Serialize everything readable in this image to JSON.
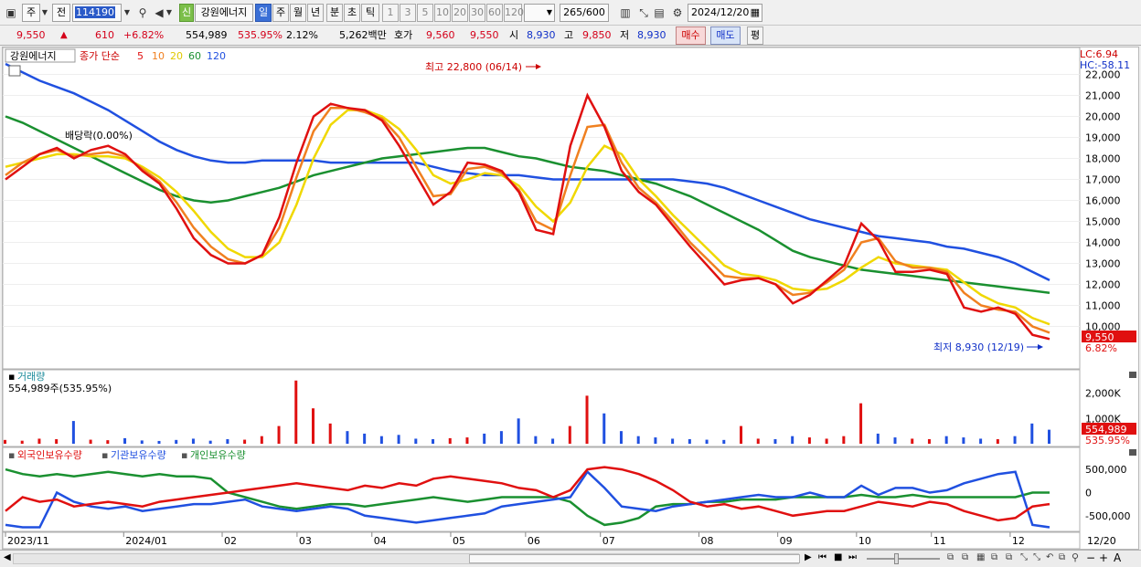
{
  "toolbar": {
    "market_label": "주",
    "prev_label": "전",
    "code_value": "114190",
    "new_badge": "신",
    "stock_name": "강원에너지",
    "period_tabs": [
      "일",
      "주",
      "월",
      "년",
      "분",
      "초",
      "틱"
    ],
    "selected_period": "일",
    "minute_units": [
      "1",
      "3",
      "5",
      "10",
      "20",
      "30",
      "60",
      "120"
    ],
    "count_value": "265",
    "count_total": "/600",
    "date_value": "2024/12/20"
  },
  "quote": {
    "price": "9,550",
    "change": "610",
    "change_pct": "+6.82%",
    "volume": "554,989",
    "volume_ratio": "535.95%",
    "turnover": "2.12%",
    "amount": "5,262백만",
    "ask_label": "호가",
    "ask": "9,560",
    "bid": "9,550",
    "open_label": "시",
    "open": "8,930",
    "high_label": "고",
    "high": "9,850",
    "low_label": "저",
    "low": "8,930",
    "buy_button": "매수",
    "sell_button": "매도",
    "eval_button": "평"
  },
  "price_panel": {
    "stock_label": "강원에너지",
    "legend_prefix": "종가 단순",
    "ma_labels": [
      "5",
      "10",
      "20",
      "60",
      "120"
    ],
    "ma_colors": [
      "#e01010",
      "#f08020",
      "#f0d800",
      "#1a9030",
      "#2050e0"
    ],
    "lc_label": "LC:6.94",
    "hc_label": "HC:-58.11",
    "high_annotation": "최고 22,800 (06/14)",
    "low_annotation": "최저 8,930 (12/19)",
    "dividend_annotation": "배당락(0.00%)",
    "current_price_tag": "9,550",
    "current_pct_tag": "6.82%"
  },
  "volume_panel": {
    "title": "거래량",
    "subtitle": "554,989주(535.95%)",
    "current_tag": "554,989",
    "current_pct_tag": "535.95%"
  },
  "holding_panel": {
    "series_labels": [
      "외국인보유수량",
      "기관보유수량",
      "개인보유수량"
    ],
    "series_colors": [
      "#e01010",
      "#2050e0",
      "#1a9030"
    ]
  },
  "chart_data": {
    "type": "line",
    "price_axis": {
      "min": 8500,
      "max": 22500,
      "ticks": [
        10000,
        11000,
        12000,
        13000,
        14000,
        15000,
        16000,
        17000,
        18000,
        19000,
        20000,
        21000,
        22000
      ]
    },
    "price_tick_labels": [
      "10,000",
      "11,000",
      "12,000",
      "13,000",
      "14,000",
      "15,000",
      "16,000",
      "17,000",
      "18,000",
      "19,000",
      "20,000",
      "21,000",
      "22,000"
    ],
    "volume_tick_labels": [
      "1,000K",
      "2,000K"
    ],
    "volume_ticks": [
      1000,
      2000
    ],
    "holding_tick_labels": [
      "500,000",
      "0",
      "-500,000"
    ],
    "holding_ticks": [
      500000,
      0,
      -500000
    ],
    "x_labels": [
      "2023/11",
      "2024/01",
      "02",
      "03",
      "04",
      "05",
      "06",
      "07",
      "08",
      "09",
      "10",
      "11",
      "12",
      "12/20"
    ],
    "x_label_positions": [
      0,
      30,
      55,
      74,
      93,
      113,
      132,
      151,
      176,
      196,
      216,
      235,
      255,
      265
    ],
    "ma5": [
      17000,
      17600,
      18200,
      18500,
      18000,
      18400,
      18600,
      18200,
      17400,
      16800,
      15600,
      14200,
      13400,
      13000,
      13000,
      13400,
      15200,
      17800,
      20000,
      20600,
      20400,
      20300,
      19800,
      18600,
      17200,
      15800,
      16400,
      17800,
      17700,
      17400,
      16400,
      14600,
      14400,
      18600,
      21000,
      19500,
      17400,
      16400,
      15800,
      14800,
      13800,
      12900,
      12000,
      12200,
      12300,
      12000,
      11100,
      11500,
      12200,
      12900,
      14900,
      14100,
      12600,
      12600,
      12700,
      12500,
      10900,
      10700,
      10900,
      10600,
      9600,
      9400
    ],
    "ma10": [
      17200,
      17800,
      18200,
      18400,
      18100,
      18200,
      18300,
      18100,
      17500,
      16900,
      15900,
      14700,
      13800,
      13200,
      13000,
      13400,
      14700,
      17100,
      19300,
      20400,
      20400,
      20200,
      19900,
      19000,
      17600,
      16200,
      16300,
      17500,
      17600,
      17300,
      16500,
      15000,
      14600,
      17200,
      19500,
      19600,
      17800,
      16600,
      15900,
      15000,
      14000,
      13200,
      12400,
      12300,
      12300,
      12000,
      11500,
      11600,
      12100,
      12700,
      14000,
      14200,
      13100,
      12800,
      12800,
      12600,
      11600,
      11000,
      10800,
      10700,
      10000,
      9700
    ],
    "ma20": [
      17600,
      17800,
      18000,
      18200,
      18200,
      18100,
      18100,
      18000,
      17600,
      17100,
      16400,
      15500,
      14500,
      13700,
      13300,
      13300,
      14000,
      15800,
      18000,
      19600,
      20300,
      20300,
      20000,
      19400,
      18400,
      17200,
      16800,
      17000,
      17300,
      17200,
      16700,
      15700,
      15000,
      15900,
      17600,
      18600,
      18200,
      17000,
      16200,
      15300,
      14500,
      13700,
      12900,
      12500,
      12400,
      12200,
      11800,
      11700,
      11800,
      12200,
      12800,
      13300,
      13000,
      12900,
      12800,
      12700,
      12100,
      11500,
      11100,
      10900,
      10400,
      10100
    ],
    "ma60": [
      20000,
      19700,
      19300,
      18900,
      18500,
      18100,
      17700,
      17300,
      16900,
      16500,
      16200,
      16000,
      15900,
      16000,
      16200,
      16400,
      16600,
      16900,
      17200,
      17400,
      17600,
      17800,
      18000,
      18100,
      18200,
      18300,
      18400,
      18500,
      18500,
      18300,
      18100,
      18000,
      17800,
      17600,
      17500,
      17400,
      17200,
      17000,
      16800,
      16500,
      16200,
      15800,
      15400,
      15000,
      14600,
      14100,
      13600,
      13300,
      13100,
      12900,
      12700,
      12600,
      12500,
      12400,
      12300,
      12200,
      12100,
      12000,
      11900,
      11800,
      11700,
      11600
    ],
    "ma120": [
      22500,
      22100,
      21700,
      21400,
      21100,
      20700,
      20300,
      19800,
      19300,
      18800,
      18400,
      18100,
      17900,
      17800,
      17800,
      17900,
      17900,
      17900,
      17900,
      17800,
      17800,
      17800,
      17800,
      17800,
      17800,
      17600,
      17400,
      17300,
      17200,
      17200,
      17200,
      17100,
      17000,
      17000,
      17000,
      17000,
      17000,
      17000,
      17000,
      17000,
      16900,
      16800,
      16600,
      16300,
      16000,
      15700,
      15400,
      15100,
      14900,
      14700,
      14500,
      14300,
      14200,
      14100,
      14000,
      13800,
      13700,
      13500,
      13300,
      13000,
      12600,
      12200
    ],
    "volume_k": [
      150,
      120,
      200,
      180,
      900,
      160,
      140,
      220,
      130,
      110,
      150,
      200,
      120,
      180,
      160,
      300,
      700,
      2500,
      1400,
      800,
      500,
      400,
      300,
      350,
      200,
      180,
      220,
      250,
      400,
      500,
      1000,
      300,
      200,
      700,
      1900,
      1200,
      500,
      300,
      250,
      200,
      180,
      160,
      150,
      700,
      200,
      180,
      300,
      250,
      200,
      300,
      1600,
      400,
      250,
      200,
      180,
      300,
      250,
      200,
      180,
      300,
      800,
      555
    ],
    "foreign_holding": [
      -400000,
      -100000,
      -200000,
      -150000,
      -300000,
      -250000,
      -200000,
      -250000,
      -300000,
      -200000,
      -150000,
      -100000,
      -50000,
      0,
      50000,
      100000,
      150000,
      200000,
      150000,
      100000,
      50000,
      150000,
      100000,
      200000,
      150000,
      300000,
      350000,
      300000,
      250000,
      200000,
      100000,
      50000,
      -100000,
      50000,
      500000,
      550000,
      500000,
      400000,
      250000,
      50000,
      -200000,
      -300000,
      -250000,
      -350000,
      -300000,
      -400000,
      -500000,
      -450000,
      -400000,
      -400000,
      -300000,
      -200000,
      -250000,
      -300000,
      -200000,
      -250000,
      -400000,
      -500000,
      -600000,
      -550000,
      -300000,
      -250000
    ],
    "inst_holding": [
      -700000,
      -750000,
      -750000,
      0,
      -200000,
      -300000,
      -350000,
      -300000,
      -400000,
      -350000,
      -300000,
      -250000,
      -250000,
      -200000,
      -150000,
      -300000,
      -350000,
      -400000,
      -350000,
      -300000,
      -350000,
      -500000,
      -550000,
      -600000,
      -650000,
      -600000,
      -550000,
      -500000,
      -450000,
      -300000,
      -250000,
      -200000,
      -150000,
      -100000,
      450000,
      100000,
      -300000,
      -350000,
      -400000,
      -300000,
      -250000,
      -200000,
      -150000,
      -100000,
      -50000,
      -100000,
      -100000,
      0,
      -100000,
      -100000,
      150000,
      -50000,
      100000,
      100000,
      0,
      50000,
      200000,
      300000,
      400000,
      450000,
      -700000,
      -750000
    ],
    "indiv_holding": [
      500000,
      400000,
      350000,
      400000,
      350000,
      400000,
      450000,
      400000,
      350000,
      400000,
      350000,
      350000,
      300000,
      0,
      -100000,
      -200000,
      -300000,
      -350000,
      -300000,
      -250000,
      -250000,
      -300000,
      -250000,
      -200000,
      -150000,
      -100000,
      -150000,
      -200000,
      -150000,
      -100000,
      -100000,
      -100000,
      -100000,
      -200000,
      -500000,
      -700000,
      -650000,
      -550000,
      -300000,
      -250000,
      -250000,
      -200000,
      -200000,
      -150000,
      -150000,
      -150000,
      -100000,
      -100000,
      -100000,
      -100000,
      -50000,
      -100000,
      -100000,
      -50000,
      -100000,
      -100000,
      -100000,
      -100000,
      -100000,
      -100000,
      0,
      0
    ]
  }
}
